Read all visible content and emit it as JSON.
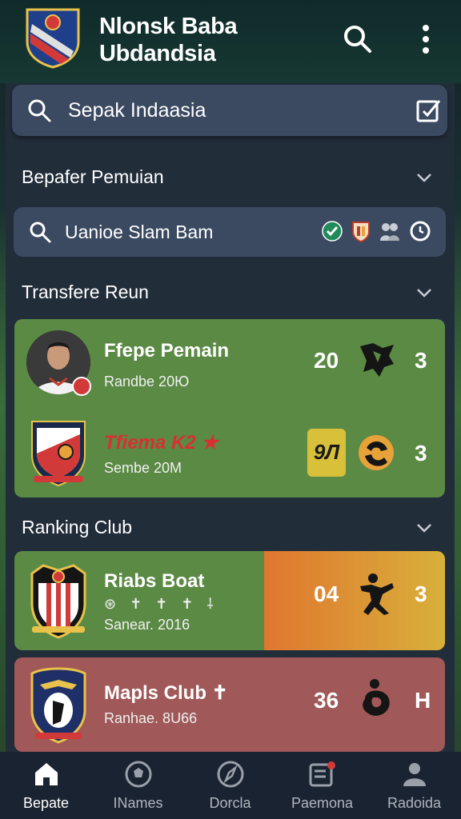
{
  "header": {
    "title_line1": "Nlonsk Baba",
    "title_line2": "Ubdandsia"
  },
  "search": {
    "text": "Sepak Indaasia"
  },
  "sections": {
    "transfer_players": "Bepafer Pemuian",
    "transfers": "Transfere Reun",
    "ranking": "Ranking Club"
  },
  "filter": {
    "text": "Uanioe Slam Bam"
  },
  "transfer_card": {
    "rows": [
      {
        "name": "Ffepe Pemain",
        "sub": "Randbe 20Ю",
        "num1": "20",
        "num2": "3"
      },
      {
        "name": "Tfiema K2 ★",
        "sub": "Sembe 20M",
        "badge": "9Л",
        "num2": "3"
      }
    ]
  },
  "ranking_cards": [
    {
      "name": "Riabs Boat",
      "sub": "Sanear. 2016",
      "num1": "04",
      "num2": "3",
      "marks": "⊛ ✝ ✝ ✝ ⸸"
    },
    {
      "name": "Mapls Club ✝",
      "sub": "Ranhae. 8U66",
      "num1": "36",
      "num2": "H"
    }
  ],
  "nav": [
    {
      "label": "Bepate",
      "icon": "home-icon"
    },
    {
      "label": "INames",
      "icon": "ball-icon"
    },
    {
      "label": "Dorcla",
      "icon": "compass-icon"
    },
    {
      "label": "Paemona",
      "icon": "news-icon"
    },
    {
      "label": "Radoida",
      "icon": "person-icon"
    }
  ],
  "colors": {
    "accent_green": "#5b8a45",
    "accent_red": "#a05858",
    "panel": "#222d3a",
    "field": "#3b4a61"
  }
}
